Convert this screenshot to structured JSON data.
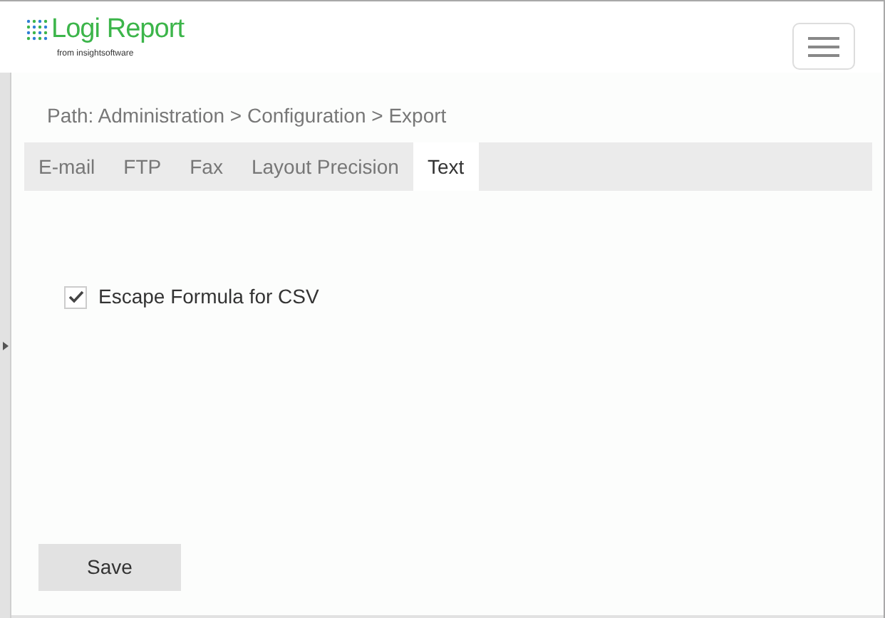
{
  "header": {
    "logo_text": "Logi Report",
    "logo_subtext": "from insightsoftware"
  },
  "path": "Path: Administration > Configuration > Export",
  "tabs": [
    {
      "label": "E-mail",
      "selected": false
    },
    {
      "label": "FTP",
      "selected": false
    },
    {
      "label": "Fax",
      "selected": false
    },
    {
      "label": "Layout Precision",
      "selected": false
    },
    {
      "label": "Text",
      "selected": true
    }
  ],
  "options": [
    {
      "label": "Escape Formula for CSV",
      "checked": true
    }
  ],
  "buttons": [
    "Save"
  ]
}
